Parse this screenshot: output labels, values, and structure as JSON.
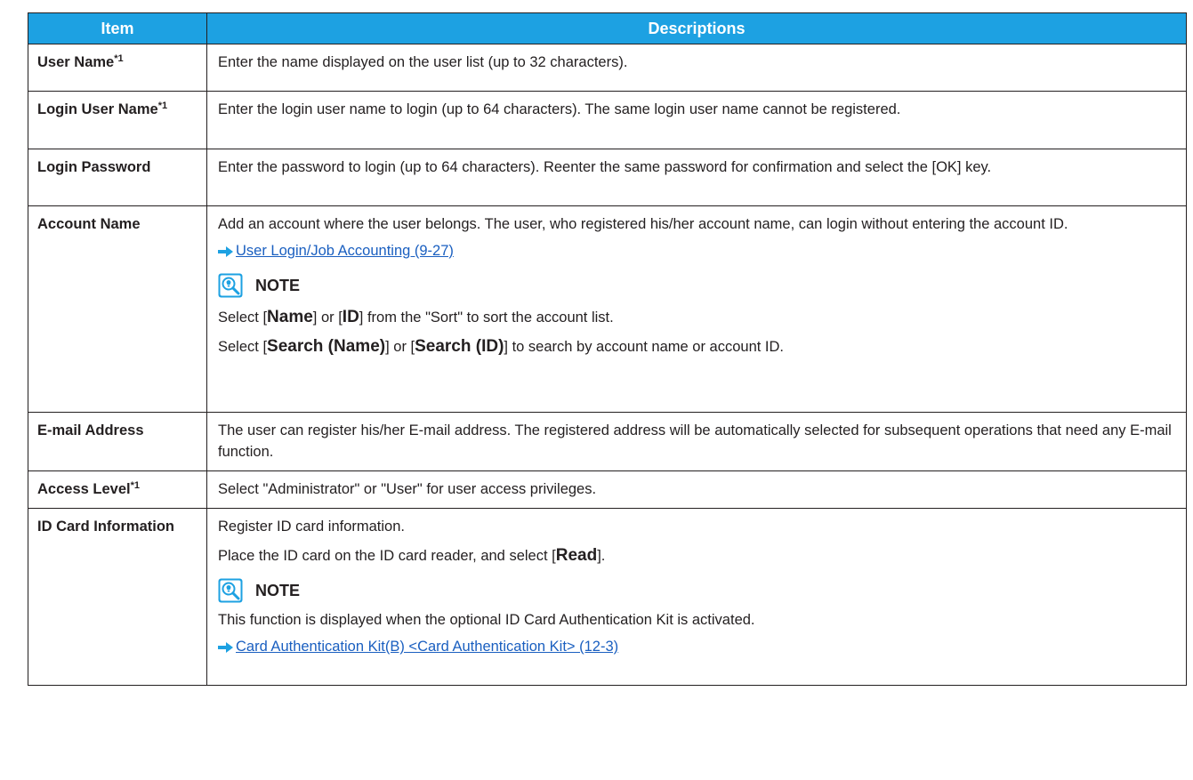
{
  "table": {
    "headers": {
      "item": "Item",
      "descriptions": "Descriptions"
    },
    "rows": {
      "user_name": {
        "item": "User Name",
        "footnote": "*1",
        "desc": "Enter the name displayed on the user list (up to 32 characters)."
      },
      "login_user_name": {
        "item": "Login User Name",
        "footnote": "*1",
        "desc": "Enter the login user name to login (up to 64 characters). The same login user name cannot be registered."
      },
      "login_password": {
        "item": "Login Password",
        "desc": "Enter the password to login (up to 64 characters). Reenter the same password for confirmation and select the [OK] key."
      },
      "account_name": {
        "item": "Account Name",
        "desc": "Add an account where the user belongs. The user, who registered his/her account name, can login without entering the account ID.",
        "link": "User Login/Job Accounting (9-27)",
        "note_title": "NOTE",
        "sort_line": {
          "t1": "Select [",
          "b1": "Name",
          "t2": "] or [",
          "b2": "ID",
          "t3": "] from the \"Sort\" to sort the account list."
        },
        "search_line": {
          "t1": "Select [",
          "b1": "Search (Name)",
          "t2": "] or [",
          "b2": "Search (ID)",
          "t3": "] to search by account name or account ID."
        }
      },
      "email_address": {
        "item": "E-mail Address",
        "desc": "The user can register his/her E-mail address. The registered address will be automatically selected for subsequent operations that need any E-mail function."
      },
      "access_level": {
        "item": "Access Level",
        "footnote": "*1",
        "desc": "Select \"Administrator\" or \"User\" for user access privileges."
      },
      "id_card_information": {
        "item": "ID Card Information",
        "desc": "Register ID card information.",
        "read_line": {
          "t1": "Place the ID card on the ID card reader, and select [",
          "b1": "Read",
          "t2": "]."
        },
        "note_title": "NOTE",
        "note_text": "This function is displayed when the optional ID Card Authentication Kit is activated.",
        "link": "Card Authentication Kit(B) <Card Authentication Kit> (12-3)"
      }
    }
  },
  "colors": {
    "header_bg": "#1da1e2",
    "link": "#1a5fc0",
    "arrow": "#1da1e2",
    "note_icon": "#1da1e2"
  },
  "icons": {
    "link_arrow": "right-arrow-icon",
    "note": "magnifier-lightbulb-icon"
  }
}
